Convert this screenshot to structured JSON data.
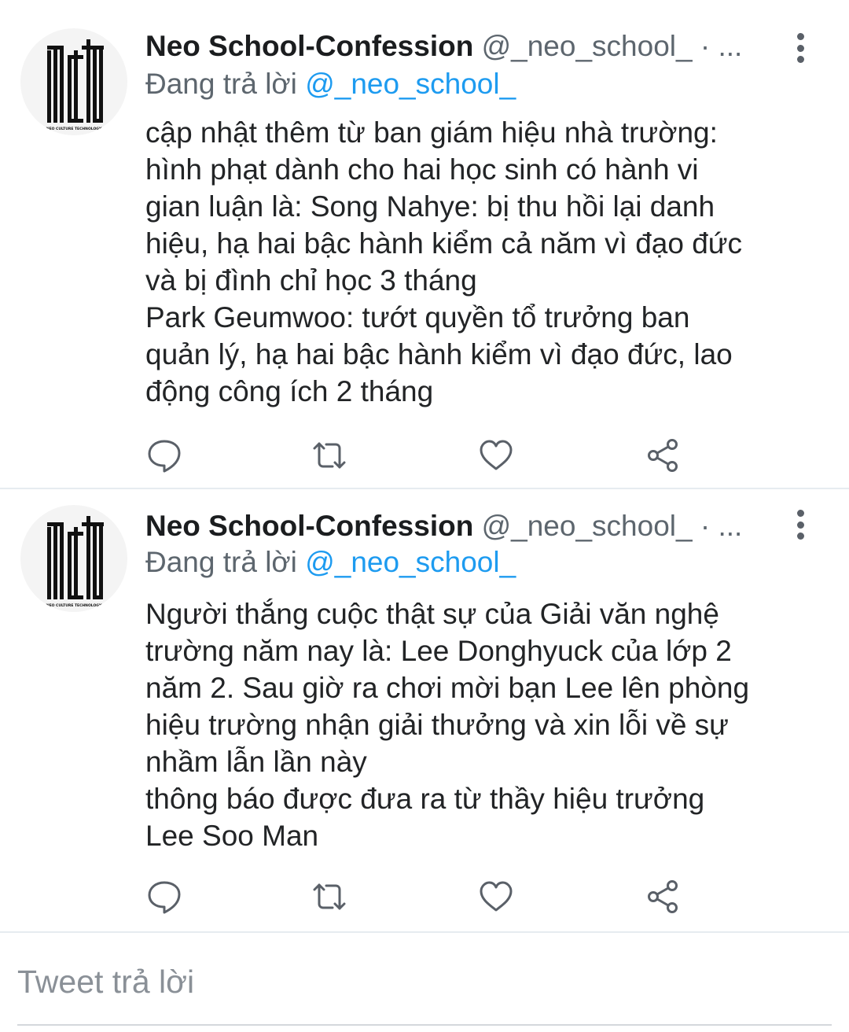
{
  "tweets": [
    {
      "display_name": "Neo School-Confession",
      "handle": "@_neo_school_ · ...",
      "reply_prefix": "Đang trả lời ",
      "reply_target": "@_neo_school_",
      "avatar_text": "NCT",
      "avatar_caption": "\"NEO CULTURE TECHNOLOGY\"",
      "body_lines": [
        "cập nhật thêm từ ban giám hiệu nhà trường:",
        "hình phạt dành cho hai học sinh có hành vi",
        "gian luận là: Song Nahye: bị thu hồi lại danh",
        "hiệu, hạ hai bậc hành kiểm cả năm vì đạo đức",
        "và bị đình chỉ học 3 tháng",
        "Park Geumwoo: tướt quyền tổ trưởng ban",
        "quản lý, hạ hai bậc hành kiểm vì đạo đức, lao",
        "động công ích 2 tháng"
      ]
    },
    {
      "display_name": "Neo School-Confession",
      "handle": "@_neo_school_ · ...",
      "reply_prefix": "Đang trả lời ",
      "reply_target": "@_neo_school_",
      "avatar_text": "NCT",
      "avatar_caption": "\"NEO CULTURE TECHNOLOGY\"",
      "body_lines": [
        "Người thắng cuộc thật sự của Giải văn nghệ",
        "trường năm nay là: Lee Donghyuck của lớp 2",
        "năm 2. Sau giờ ra chơi mời bạn Lee lên phòng",
        "hiệu trường nhận giải thưởng và xin lỗi về sự",
        "nhầm lẫn lần này",
        "thông báo được đưa ra từ thầy hiệu trưởng",
        "Lee Soo Man"
      ]
    }
  ],
  "actions": {
    "reply_icon": "reply-icon",
    "retweet_icon": "retweet-icon",
    "like_icon": "heart-icon",
    "share_icon": "share-icon"
  },
  "reply_bar": {
    "placeholder": "Tweet trả lời"
  },
  "colors": {
    "link": "#1d9bf0",
    "secondary_text": "#5d666e",
    "icon": "#5a6068",
    "divider": "#e6ecf0"
  }
}
